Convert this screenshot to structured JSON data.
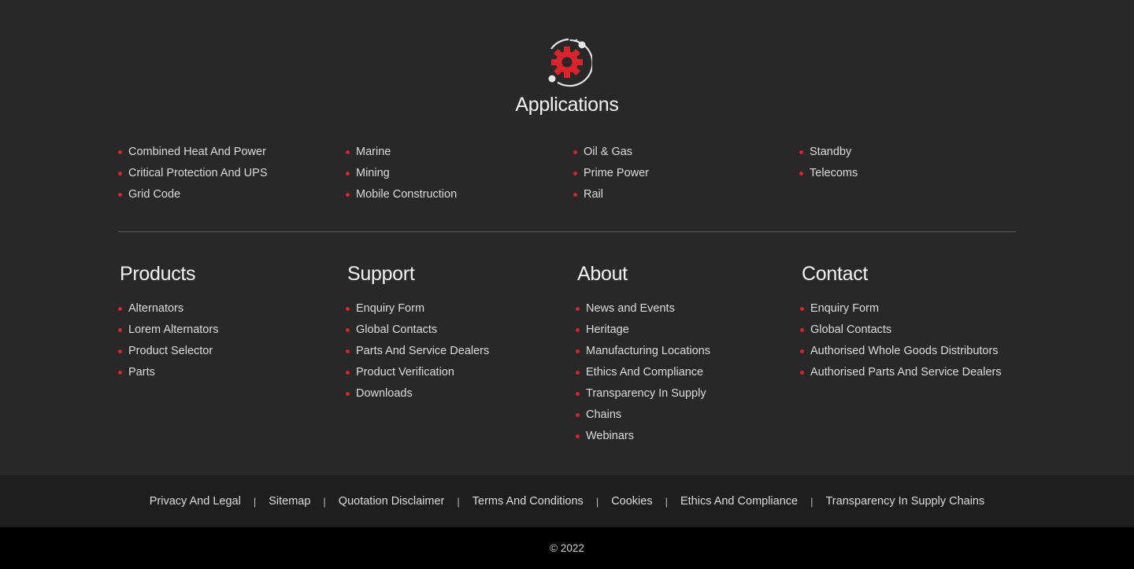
{
  "applications": {
    "title": "Applications",
    "columns": [
      [
        "Combined Heat And Power",
        "Critical Protection And UPS",
        "Grid Code"
      ],
      [
        "Marine",
        "Mining",
        "Mobile Construction"
      ],
      [
        "Oil & Gas",
        "Prime Power",
        "Rail"
      ],
      [
        "Standby",
        "Telecoms"
      ]
    ]
  },
  "footer": {
    "products": {
      "title": "Products",
      "items": [
        "Alternators",
        "Lorem Alternators",
        "Product Selector",
        "Parts"
      ]
    },
    "support": {
      "title": "Support",
      "items": [
        "Enquiry Form",
        "Global Contacts",
        "Parts And Service Dealers",
        "Product Verification",
        "Downloads"
      ]
    },
    "about": {
      "title": "About",
      "items": [
        "News and Events",
        "Heritage",
        "Manufacturing Locations",
        "Ethics And Compliance",
        "Transparency In Supply",
        "Chains",
        "Webinars"
      ]
    },
    "contact": {
      "title": "Contact",
      "items": [
        "Enquiry Form",
        "Global Contacts",
        "Authorised Whole Goods Distributors",
        "Authorised Parts And Service Dealers"
      ]
    }
  },
  "legal": {
    "links": [
      "Privacy And Legal",
      "Sitemap",
      "Quotation Disclaimer",
      "Terms And Conditions",
      "Cookies",
      "Ethics And Compliance",
      "Transparency In Supply Chains"
    ],
    "separator": "|"
  },
  "copyright": "© 2022",
  "colors": {
    "accent": "#d8242d",
    "background": "#282828",
    "legal_bar": "#1e1e1e",
    "bottom_bar": "#000000"
  },
  "icons": {
    "applications": "gear-orbit-icon"
  }
}
